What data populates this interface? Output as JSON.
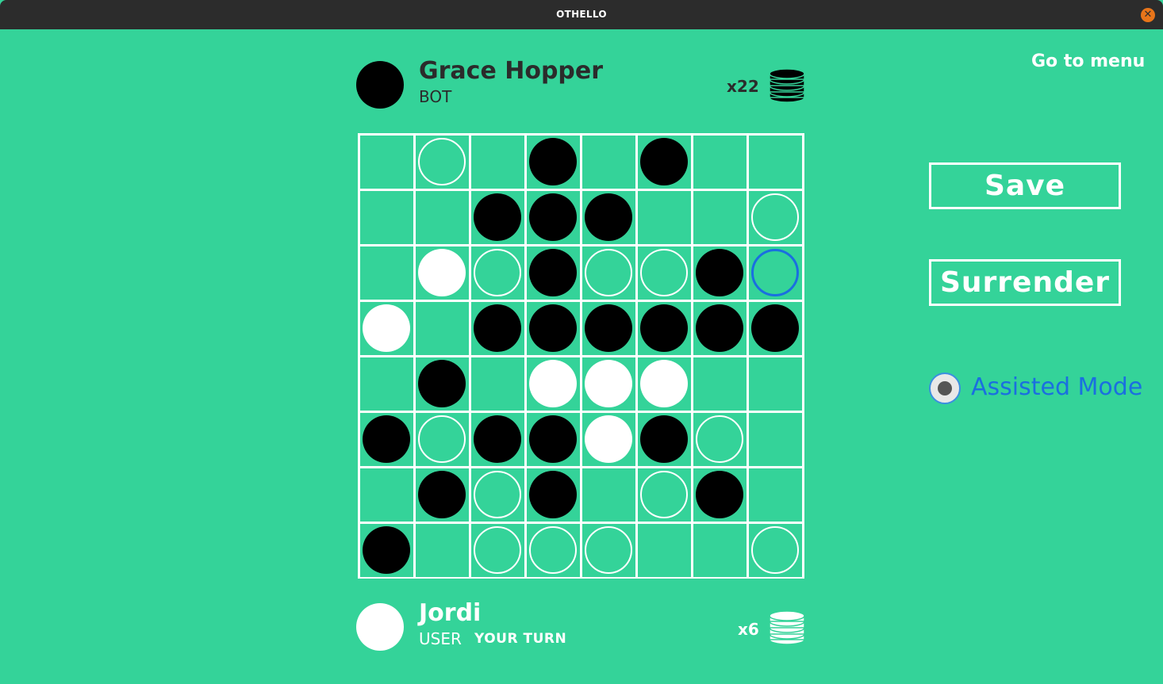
{
  "window": {
    "title": "OTHELLO",
    "close_icon": "close-icon"
  },
  "menu_link": "Go to menu",
  "top_player": {
    "name": "Grace Hopper",
    "role": "BOT",
    "count": "x22",
    "color": "#000000"
  },
  "bottom_player": {
    "name": "Jordi",
    "role": "USER",
    "turn": "YOUR TURN",
    "count": "x6",
    "color": "#ffffff"
  },
  "buttons": {
    "save": "Save",
    "surrender": "Surrender"
  },
  "assisted_mode": {
    "label": "Assisted Mode",
    "selected": true
  },
  "colors": {
    "background": "#34d399",
    "grid": "#ffffff",
    "highlight": "#1a6fe0"
  },
  "board": {
    "legend": {
      "B": "black disc",
      "W": "white disc",
      "H": "valid move hint",
      "A": "active hint",
      "E": "empty"
    },
    "rows": [
      [
        "E",
        "H",
        "E",
        "B",
        "E",
        "B",
        "E",
        "E"
      ],
      [
        "E",
        "E",
        "B",
        "B",
        "B",
        "E",
        "E",
        "H"
      ],
      [
        "E",
        "W",
        "H",
        "B",
        "H",
        "H",
        "B",
        "A"
      ],
      [
        "W",
        "E",
        "B",
        "B",
        "B",
        "B",
        "B",
        "B"
      ],
      [
        "E",
        "B",
        "E",
        "W",
        "W",
        "W",
        "E",
        "E"
      ],
      [
        "B",
        "H",
        "B",
        "B",
        "W",
        "B",
        "H",
        "E"
      ],
      [
        "E",
        "B",
        "H",
        "B",
        "E",
        "H",
        "B",
        "E"
      ],
      [
        "B",
        "E",
        "H",
        "H",
        "H",
        "E",
        "E",
        "H"
      ]
    ]
  }
}
